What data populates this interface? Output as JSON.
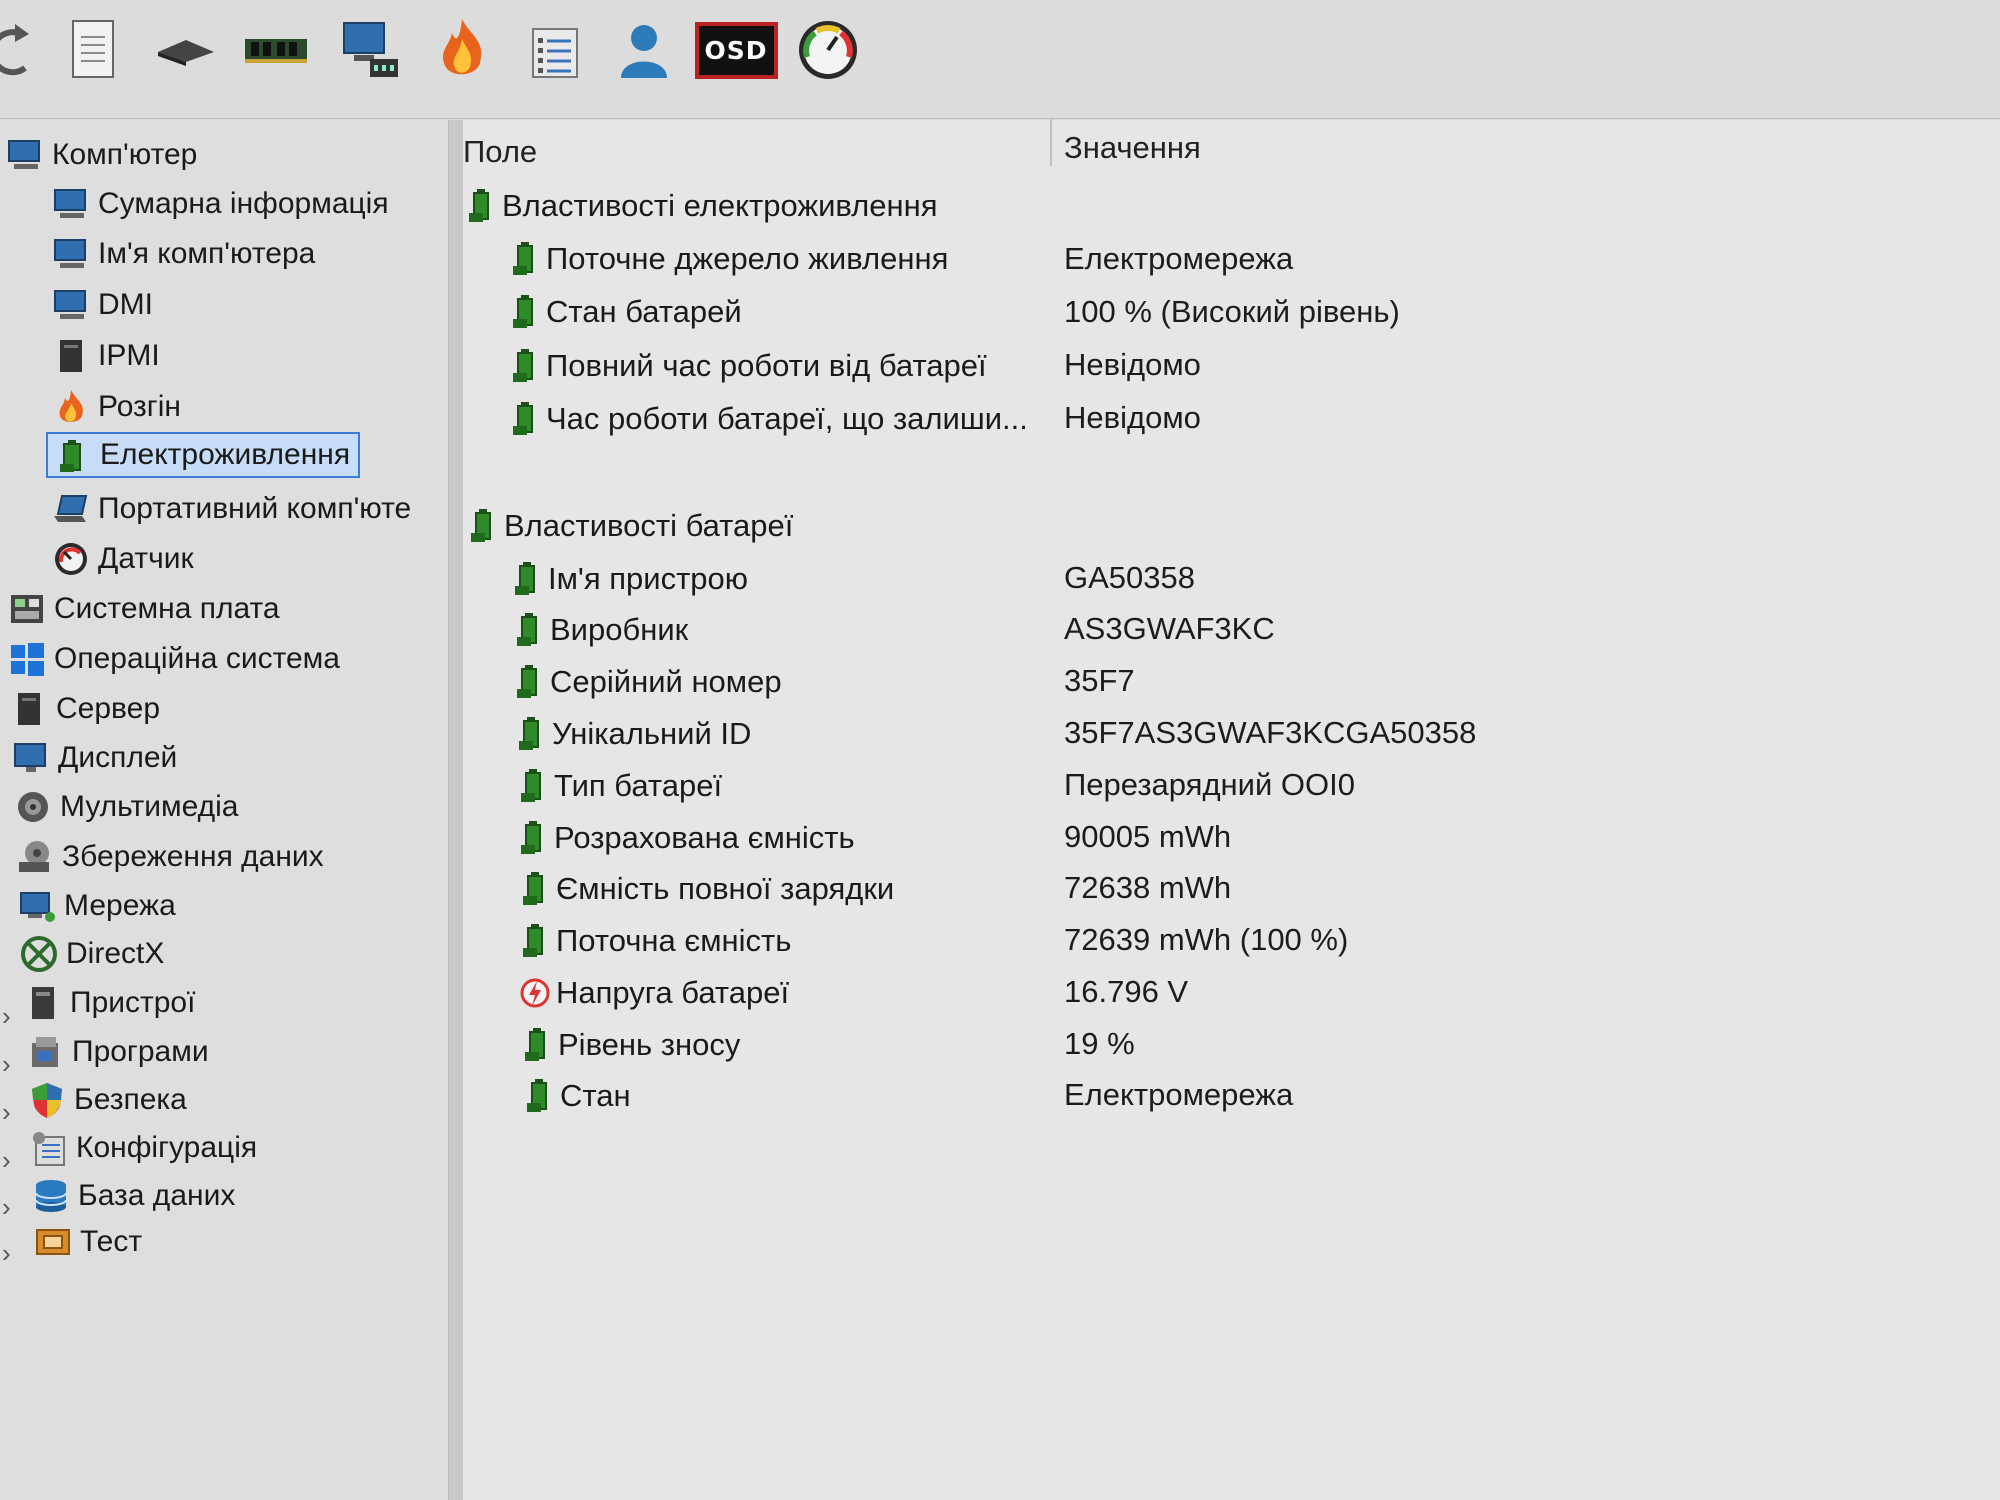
{
  "toolbar": {
    "buttons": [
      {
        "name": "refresh-icon"
      },
      {
        "name": "report-icon"
      },
      {
        "name": "storage-icon"
      },
      {
        "name": "memory-icon"
      },
      {
        "name": "network-computer-icon"
      },
      {
        "name": "flame-icon"
      },
      {
        "name": "checklist-icon"
      },
      {
        "name": "user-icon"
      },
      {
        "name": "osd-icon",
        "label": "OSD"
      },
      {
        "name": "gauge-icon"
      }
    ]
  },
  "sidebar": {
    "items": [
      {
        "label": "Комп'ютер",
        "icon": "computer-icon"
      },
      {
        "label": "Сумарна інформація",
        "icon": "computer-icon"
      },
      {
        "label": "Ім'я комп'ютера",
        "icon": "computer-icon"
      },
      {
        "label": "DMI",
        "icon": "computer-icon"
      },
      {
        "label": "IPMI",
        "icon": "server-icon"
      },
      {
        "label": "Розгін",
        "icon": "flame-icon"
      },
      {
        "label": "Електроживлення",
        "icon": "battery-icon",
        "selected": true
      },
      {
        "label": "Портативний комп'юте",
        "icon": "laptop-icon"
      },
      {
        "label": "Датчик",
        "icon": "gauge-icon"
      },
      {
        "label": "Системна плата",
        "icon": "motherboard-icon"
      },
      {
        "label": "Операційна система",
        "icon": "windows-icon"
      },
      {
        "label": "Сервер",
        "icon": "server-icon"
      },
      {
        "label": "Дисплей",
        "icon": "monitor-icon"
      },
      {
        "label": "Мультимедіа",
        "icon": "speaker-icon"
      },
      {
        "label": "Збереження даних",
        "icon": "disk-icon"
      },
      {
        "label": "Мережа",
        "icon": "network-icon"
      },
      {
        "label": "DirectX",
        "icon": "xbox-icon"
      },
      {
        "label": "Пристрої",
        "icon": "devices-icon"
      },
      {
        "label": "Програми",
        "icon": "programs-icon"
      },
      {
        "label": "Безпека",
        "icon": "shield-icon"
      },
      {
        "label": "Конфігурація",
        "icon": "config-icon"
      },
      {
        "label": "База даних",
        "icon": "database-icon"
      },
      {
        "label": "Тест",
        "icon": "test-icon"
      }
    ]
  },
  "table": {
    "headers": {
      "field": "Поле",
      "value": "Значення"
    },
    "groups": [
      {
        "title": "Властивості електроживлення",
        "rows": [
          {
            "field": "Поточне джерело живлення",
            "value": "Електромережа"
          },
          {
            "field": "Стан батарей",
            "value": "100 % (Високий рівень)"
          },
          {
            "field": "Повний час роботи від батареї",
            "value": "Невідомо"
          },
          {
            "field": "Час роботи батареї, що залиши...",
            "value": "Невідомо"
          }
        ]
      },
      {
        "title": "Властивості батареї",
        "rows": [
          {
            "field": "Ім'я пристрою",
            "value": "GA50358"
          },
          {
            "field": "Виробник",
            "value": "AS3GWAF3KC"
          },
          {
            "field": "Серійний номер",
            "value": "35F7"
          },
          {
            "field": "Унікальний ID",
            "value": "35F7AS3GWAF3KCGA50358"
          },
          {
            "field": "Тип батареї",
            "value": "Перезарядний OOI0"
          },
          {
            "field": "Розрахована ємність",
            "value": "90005 mWh"
          },
          {
            "field": "Ємність повної зарядки",
            "value": "72638 mWh"
          },
          {
            "field": "Поточна ємність",
            "value": "72639 mWh  (100 %)"
          },
          {
            "field": "Напруга батареї",
            "value": "16.796 V",
            "icon": "voltage-icon"
          },
          {
            "field": "Рівень зносу",
            "value": "19 %"
          },
          {
            "field": "Стан",
            "value": "Електромережа"
          }
        ]
      }
    ]
  },
  "colors": {
    "selection": "#c6dcf7",
    "selection_border": "#3b7bd8",
    "battery_green": "#2f8a2a"
  }
}
